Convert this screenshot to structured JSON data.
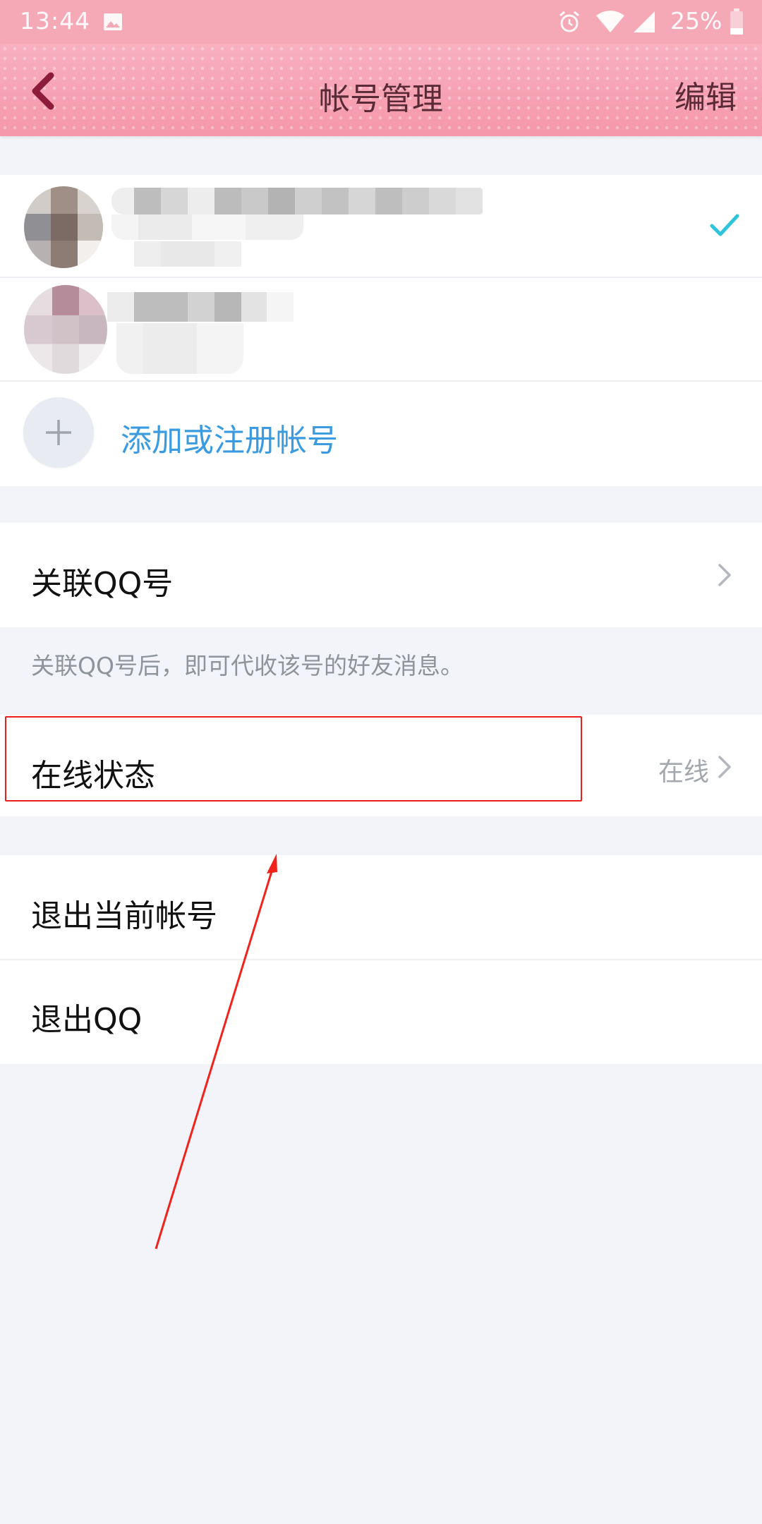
{
  "status_bar": {
    "time": "13:44",
    "battery_percent": "25%",
    "icons": [
      "image-icon",
      "alarm-icon",
      "wifi-icon",
      "signal-icon",
      "battery-icon"
    ]
  },
  "header": {
    "title": "帐号管理",
    "edit_label": "编辑",
    "back_icon": "chevron-left-icon"
  },
  "accounts": [
    {
      "selected": true
    },
    {
      "selected": false
    }
  ],
  "add_account": {
    "label": "添加或注册帐号",
    "icon": "plus-icon"
  },
  "linked_qq": {
    "label": "关联QQ号",
    "hint": "关联QQ号后，即可代收该号的好友消息。"
  },
  "online_status": {
    "label": "在线状态",
    "value": "在线"
  },
  "logout": {
    "label": "退出当前帐号"
  },
  "quit": {
    "label": "退出QQ"
  },
  "colors": {
    "header_pink": "#f7a1b2",
    "link_blue": "#3a9be0",
    "check_cyan": "#2ec4dc",
    "annotation_red": "#e8201c"
  }
}
